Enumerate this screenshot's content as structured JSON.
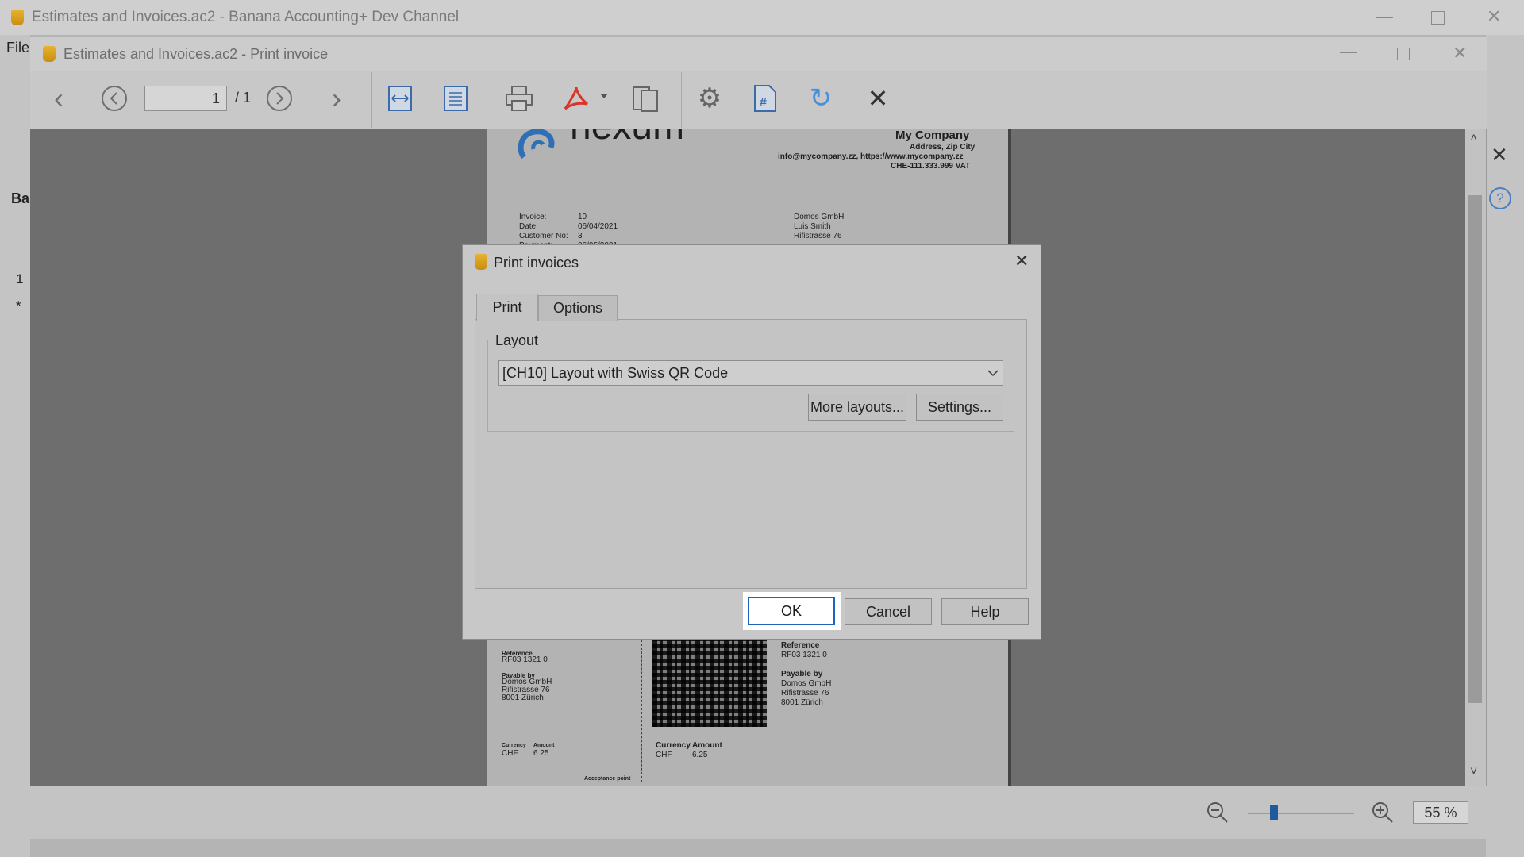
{
  "main_window": {
    "title": "Estimates and Invoices.ac2 - Banana Accounting+ Dev Channel",
    "menu_file": "File",
    "side_label": "Ba",
    "row_1": "1",
    "row_star": "*"
  },
  "print_window": {
    "title": "Estimates and Invoices.ac2 - Print invoice",
    "page_current": "1",
    "page_total": "/ 1",
    "zoom": "55 %"
  },
  "invoice": {
    "logo_text": "nexum",
    "company": "My Company",
    "address": "Address, Zip City",
    "contact": "info@mycompany.zz, https://www.mycompany.zz",
    "vat": "CHE-111.333.999 VAT",
    "invoice_label": "Invoice:",
    "invoice_value": "10",
    "date_label": "Date:",
    "date_value": "06/04/2021",
    "customer_label": "Customer No:",
    "customer_value": "3",
    "payment_label": "Payment:",
    "payment_value": "06/05/2021",
    "cust_name": "Domos GmbH",
    "cust_person": "Luis Smith",
    "cust_street": "Rifistrasse 76",
    "receipt": {
      "reference_label": "Reference",
      "reference": "RF03 1321 0",
      "payable_label": "Payable by",
      "payable_1": "Domos GmbH",
      "payable_2": "Rifistrasse 76",
      "payable_3": "8001 Zürich",
      "currency_label": "Currency",
      "amount_label": "Amount",
      "currency": "CHF",
      "amount": "6.25",
      "acceptance": "Acceptance point"
    },
    "payment_part": {
      "reference_label": "Reference",
      "reference": "RF03 1321 0",
      "payable_label": "Payable by",
      "payable_1": "Domos GmbH",
      "payable_2": "Rifistrasse 76",
      "payable_3": "8001 Zürich",
      "currency_label": "Currency",
      "amount_label": "Amount",
      "currency": "CHF",
      "amount": "6.25"
    }
  },
  "dialog": {
    "title": "Print invoices",
    "tabs": [
      "Print",
      "Options"
    ],
    "layout_group": "Layout",
    "layout_selected": "[CH10] Layout with Swiss QR Code",
    "more_layouts": "More layouts...",
    "settings": "Settings...",
    "ok": "OK",
    "cancel": "Cancel",
    "help": "Help"
  },
  "icons": [
    "app-icon",
    "minimize-icon",
    "maximize-icon",
    "close-icon",
    "chevron-left-icon",
    "circle-left-icon",
    "circle-right-icon",
    "chevron-right-icon",
    "fit-width-icon",
    "fit-page-icon",
    "printer-icon",
    "pdf-icon",
    "copy-pages-icon",
    "gear-icon",
    "page-number-icon",
    "refresh-icon",
    "close-preview-icon",
    "zoom-out-icon",
    "zoom-in-icon",
    "help-icon",
    "dropdown-chevron-icon"
  ],
  "colors": {
    "accent": "#1f63b8",
    "app_icon": "#d9a21c",
    "refresh": "#4a8fd8"
  }
}
